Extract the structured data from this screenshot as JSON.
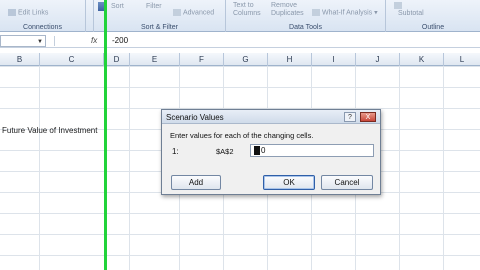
{
  "ribbon": {
    "connections": {
      "edit_links": "Edit Links",
      "group_label": "Connections"
    },
    "sort_filter": {
      "sort": "Sort",
      "filter": "Filter",
      "advanced": "Advanced",
      "group_label": "Sort & Filter"
    },
    "data_tools": {
      "text_to_columns": "Text to Columns",
      "remove_duplicates": "Remove Duplicates",
      "what_if": "What-If Analysis",
      "group_label": "Data Tools"
    },
    "outline": {
      "subtotal": "Subtotal",
      "group_label": "Outline"
    }
  },
  "formula_bar": {
    "fx_label": "fx",
    "value": "-200"
  },
  "columns": [
    "B",
    "C",
    "D",
    "E",
    "F",
    "G",
    "H",
    "I",
    "J",
    "K",
    "L"
  ],
  "cells": {
    "label": "Future Value of Investment"
  },
  "dialog": {
    "title": "Scenario Values",
    "help_label": "?",
    "close_label": "X",
    "instruction": "Enter values for each of the changing cells.",
    "row_number": "1:",
    "cell_ref": "$A$2",
    "input_value": "0",
    "add_label": "Add",
    "ok_label": "OK",
    "cancel_label": "Cancel"
  }
}
